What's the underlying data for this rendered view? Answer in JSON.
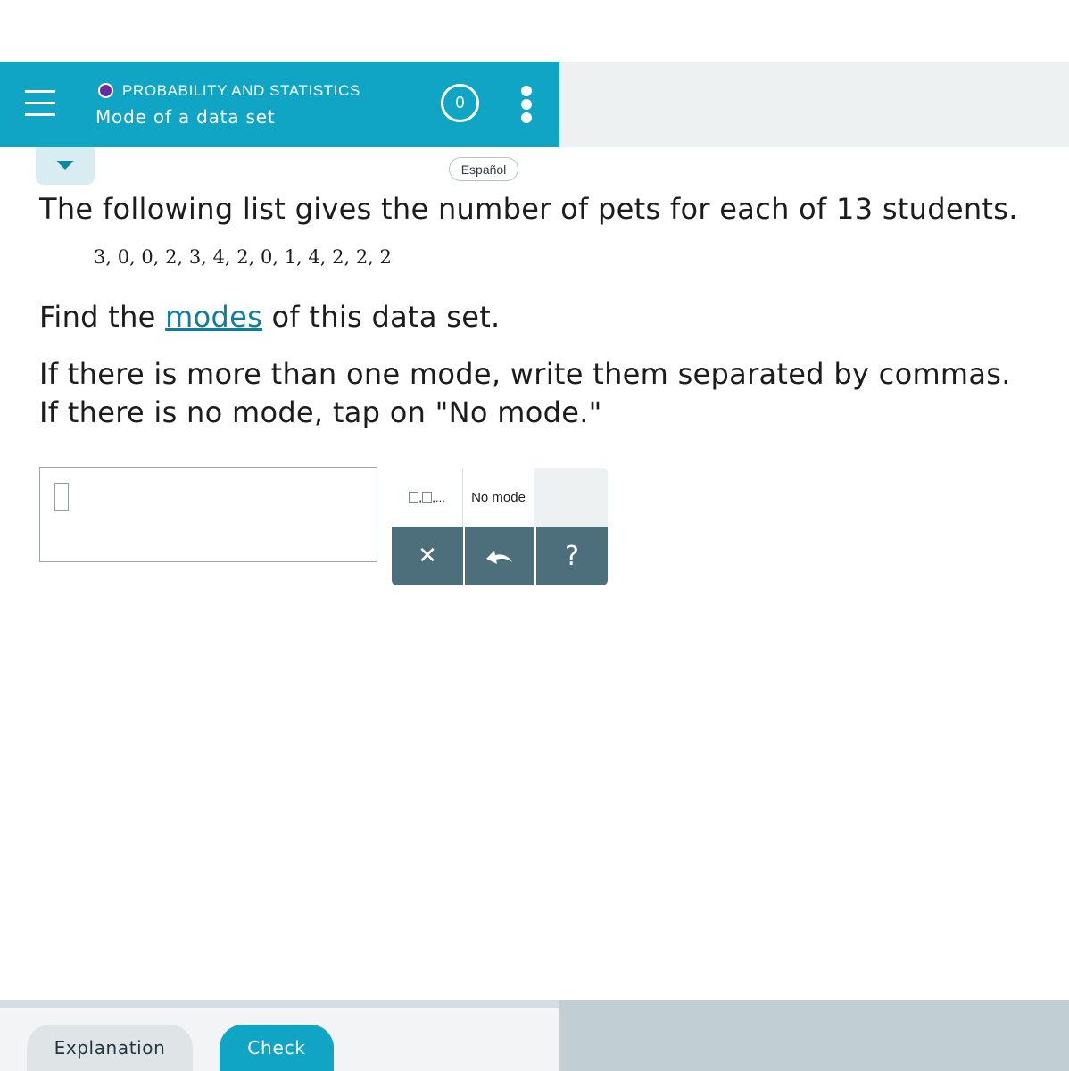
{
  "header": {
    "topic": "PROBABILITY AND STATISTICS",
    "lesson": "Mode of a data set",
    "counter": "0",
    "accent_color": "#10a5c5",
    "topic_dot_color": "#6a2c9c"
  },
  "language_button": "Español",
  "question": {
    "intro": "The following list gives the number of pets for each of 13 students.",
    "data_list": "3, 0, 0, 2, 3, 4, 2, 0, 1, 4, 2, 2, 2",
    "find_before": "Find the ",
    "find_link": "modes",
    "find_after": " of this data set.",
    "instruction_1": "If there is more than one mode, write them separated by commas.",
    "instruction_2": "If there is no mode, tap on \"No mode.\""
  },
  "answer": {
    "value": ""
  },
  "keypad": {
    "list_key_sep": ", ",
    "list_key_ellipsis": "...",
    "no_mode_label": "No mode",
    "clear_symbol": "✕",
    "undo_icon": "undo-icon",
    "help_symbol": "?"
  },
  "footer": {
    "explanation_label": "Explanation",
    "check_label": "Check"
  }
}
